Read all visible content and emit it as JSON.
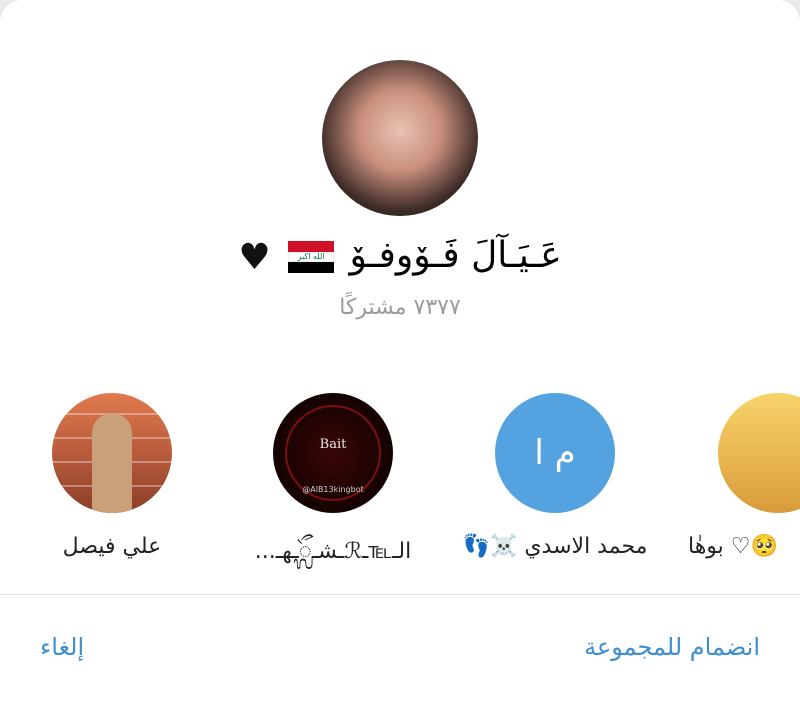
{
  "group": {
    "title": "عَـيَـآلَ فَـۆوفـۆ",
    "flag_text": "الله اكبر",
    "subscribers_label": "٧٣٧٧ مشتركًا"
  },
  "members": [
    {
      "name": "علي فيصل",
      "avatar_type": "photo"
    },
    {
      "name": "الـ℡ـℛـشـᬼـهـ...",
      "avatar_type": "logo",
      "logo_text": "Bait",
      "logo_sub": "@AlB13kingbot"
    },
    {
      "name": "محمد الاسدي ☠️👣",
      "avatar_type": "initials",
      "initials": "م ا"
    },
    {
      "name": "🥺♡ بوهٰا",
      "avatar_type": "photo"
    }
  ],
  "actions": {
    "join_label": "انضمام للمجموعة",
    "cancel_label": "إلغاء"
  },
  "colors": {
    "accent": "#3f8fd0",
    "initials_bg": "#54a3e0",
    "subtitle": "#9b9b9b"
  }
}
